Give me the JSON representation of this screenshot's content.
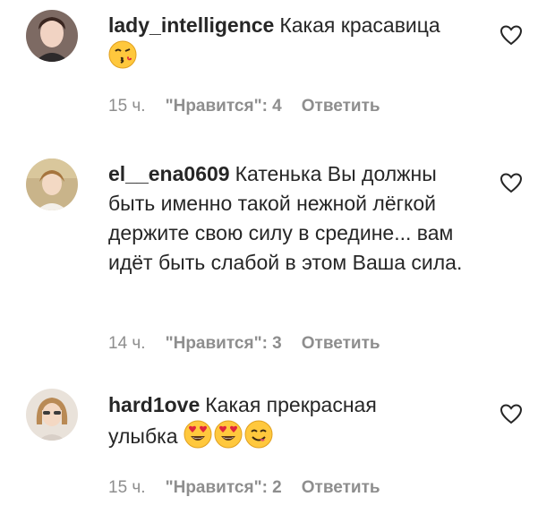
{
  "comments": [
    {
      "username": "lady_intelligence",
      "text": "Какая красавица",
      "emojis": [
        "face-blowing-kiss-emoji"
      ],
      "time": "15 ч.",
      "likes": "\"Нравится\": 4",
      "reply": "Ответить"
    },
    {
      "username": "el__ena0609",
      "text": "Катенька Вы должны быть именно такой нежной лёгкой держите свою силу в средине... вам идёт быть слабой в этом Ваша сила.",
      "emojis": [],
      "time": "14 ч.",
      "likes": "\"Нравится\": 3",
      "reply": "Ответить"
    },
    {
      "username": "hard1ove",
      "text": "Какая прекрасная улыбка",
      "emojis": [
        "heart-eyes-emoji",
        "heart-eyes-emoji",
        "savoring-food-emoji"
      ],
      "time": "15 ч.",
      "likes": "\"Нравится\": 2",
      "reply": "Ответить"
    }
  ],
  "icons": {
    "like": "heart-outline-icon"
  },
  "colors": {
    "text": "#262626",
    "meta": "#8e8e8e",
    "emoji_yellow": "#ffc83d",
    "emoji_red": "#e0263c"
  }
}
